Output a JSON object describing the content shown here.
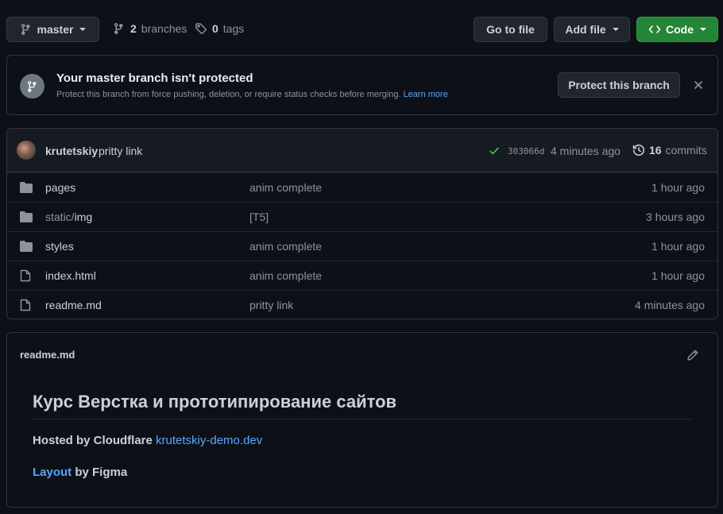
{
  "toolbar": {
    "branch_label": "master",
    "branches_count": "2",
    "branches_label": "branches",
    "tags_count": "0",
    "tags_label": "tags",
    "go_to_file": "Go to file",
    "add_file": "Add file",
    "code": "Code"
  },
  "banner": {
    "title": "Your master branch isn't protected",
    "description": "Protect this branch from force pushing, deletion, or require status checks before merging.",
    "learn_more": "Learn more",
    "protect_button": "Protect this branch"
  },
  "commit": {
    "author": "krutetskiy",
    "message": "pritty link",
    "sha": "303066d",
    "time": "4 minutes ago",
    "commits_count": "16",
    "commits_label": "commits"
  },
  "files": [
    {
      "type": "dir",
      "name": "pages",
      "message": "anim complete",
      "age": "1 hour ago"
    },
    {
      "type": "dir",
      "name_prefix": "static/",
      "name": "img",
      "message": "[T5]",
      "age": "3 hours ago"
    },
    {
      "type": "dir",
      "name": "styles",
      "message": "anim complete",
      "age": "1 hour ago"
    },
    {
      "type": "file",
      "name": "index.html",
      "message": "anim complete",
      "age": "1 hour ago"
    },
    {
      "type": "file",
      "name": "readme.md",
      "message": "pritty link",
      "age": "4 minutes ago"
    }
  ],
  "readme": {
    "filename": "readme.md",
    "heading": "Курс Верстка и прототипирование сайтов",
    "hosted_prefix": "Hosted by Cloudflare",
    "hosted_link": "krutetskiy-demo.dev",
    "layout_link": "Layout",
    "layout_suffix": "by Figma"
  },
  "colors": {
    "background": "#0d1117",
    "accent_green": "#238636",
    "link_blue": "#58a6ff",
    "check_green": "#3fb950"
  }
}
